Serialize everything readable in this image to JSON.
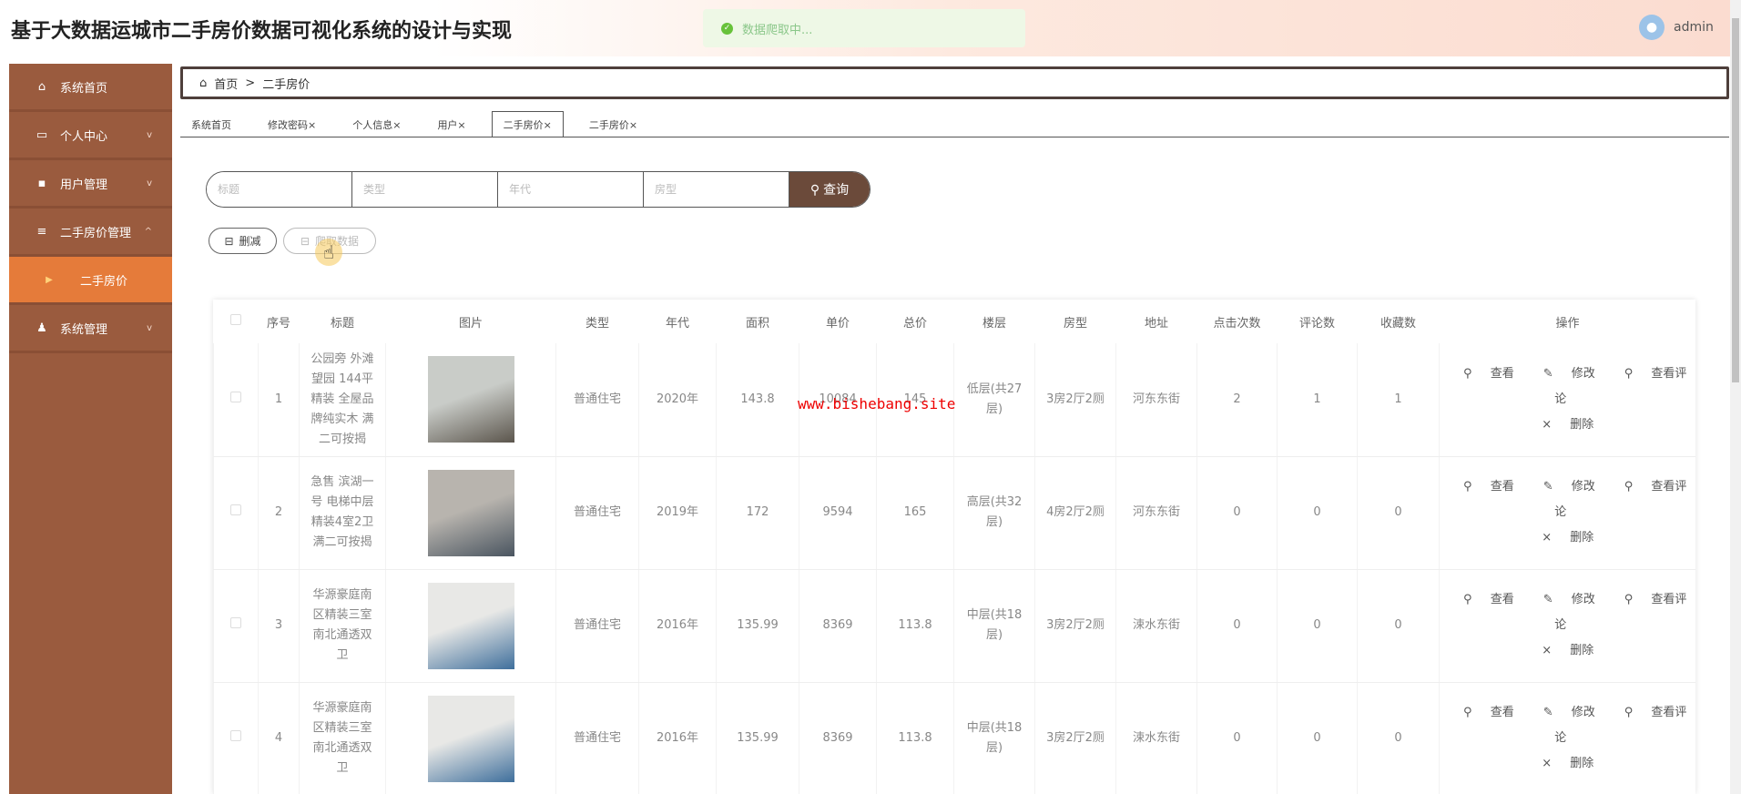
{
  "header": {
    "title": "基于大数据运城市二手房价数据可视化系统的设计与实现",
    "toast": "数据爬取中...",
    "username": "admin"
  },
  "sidebar": {
    "items": [
      {
        "label": "系统首页",
        "icon": "home-icon",
        "glyph": "⌂"
      },
      {
        "label": "个人中心",
        "icon": "card-icon",
        "glyph": "▭",
        "chevron": "﹀"
      },
      {
        "label": "用户管理",
        "icon": "chat-icon",
        "glyph": "▪",
        "chevron": "﹀"
      },
      {
        "label": "二手房价管理",
        "icon": "menu-icon",
        "glyph": "≡",
        "chevron": "︿"
      },
      {
        "label": "二手房价",
        "icon": "caret-right-icon",
        "glyph": "▶",
        "sub": true
      },
      {
        "label": "系统管理",
        "icon": "user-icon",
        "glyph": "♟",
        "chevron": "﹀"
      }
    ]
  },
  "breadcrumb": {
    "home": "首页",
    "separator": ">",
    "current": "二手房价"
  },
  "tabs": [
    {
      "label": "系统首页"
    },
    {
      "label": "修改密码×"
    },
    {
      "label": "个人信息×"
    },
    {
      "label": "用户×"
    },
    {
      "label": "二手房价×",
      "active": true
    },
    {
      "label": "二手房价×"
    }
  ],
  "search": {
    "placeholders": [
      "标题",
      "类型",
      "年代",
      "房型"
    ],
    "button": "查询"
  },
  "actions": {
    "delete": "删减",
    "crawl": "爬取数据"
  },
  "watermark": "www.bishebang.site",
  "table": {
    "columns": [
      "",
      "序号",
      "标题",
      "图片",
      "类型",
      "年代",
      "面积",
      "单价",
      "总价",
      "楼层",
      "房型",
      "地址",
      "点击次数",
      "评论数",
      "收藏数",
      "操作"
    ],
    "ops": [
      "查看",
      "修改",
      "查看评论",
      "删除"
    ],
    "rows": [
      {
        "no": "1",
        "title": "公园旁 外滩望园 144平精装 全屋品牌纯实木 满二可按揭",
        "type": "普通住宅",
        "year": "2020年",
        "area": "143.8",
        "unit": "10084",
        "total": "145",
        "floor": "低层(共27层)",
        "layout": "3房2厅2厕",
        "addr": "河东东街",
        "clicks": "2",
        "comments": "1",
        "favs": "1",
        "img": [
          "#c9ccc8",
          "#5b554c"
        ]
      },
      {
        "no": "2",
        "title": "急售 滨湖一号 电梯中层 精装4室2卫 满二可按揭",
        "type": "普通住宅",
        "year": "2019年",
        "area": "172",
        "unit": "9594",
        "total": "165",
        "floor": "高层(共32层)",
        "layout": "4房2厅2厕",
        "addr": "河东东街",
        "clicks": "0",
        "comments": "0",
        "favs": "0",
        "img": [
          "#b8b4ae",
          "#4a5560"
        ]
      },
      {
        "no": "3",
        "title": "华源豪庭南区精装三室南北通透双卫",
        "type": "普通住宅",
        "year": "2016年",
        "area": "135.99",
        "unit": "8369",
        "total": "113.8",
        "floor": "中层(共18层)",
        "layout": "3房2厅2厕",
        "addr": "涑水东街",
        "clicks": "0",
        "comments": "0",
        "favs": "0",
        "img": [
          "#e8e8e6",
          "#3f6f9c"
        ]
      },
      {
        "no": "4",
        "title": "华源豪庭南区精装三室南北通透双卫",
        "type": "普通住宅",
        "year": "2016年",
        "area": "135.99",
        "unit": "8369",
        "total": "113.8",
        "floor": "中层(共18层)",
        "layout": "3房2厅2厕",
        "addr": "涑水东街",
        "clicks": "0",
        "comments": "0",
        "favs": "0",
        "img": [
          "#e8e8e6",
          "#3f6f9c"
        ]
      }
    ]
  }
}
